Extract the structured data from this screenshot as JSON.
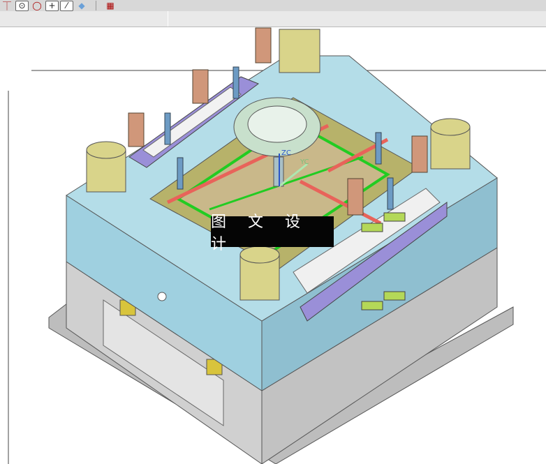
{
  "toolbar": {
    "icons": [
      "datum-icon",
      "point-on-circle-icon",
      "circle-points-icon",
      "crosshair-icon",
      "line-icon",
      "shaded-view-icon",
      "grid-icon"
    ]
  },
  "viewport": {
    "axis_labels": {
      "z": "ZC",
      "y": "YC"
    },
    "colors": {
      "top_plate": "#a8d4dc",
      "base": "#c8c8c8",
      "cavity": "#b7b26a",
      "bushing": "#d9d48a",
      "cooling": "#e8635a",
      "runner": "#22cc22",
      "bolt": "#6d9bc4"
    }
  },
  "watermark": {
    "text": "图 文 设 计"
  }
}
